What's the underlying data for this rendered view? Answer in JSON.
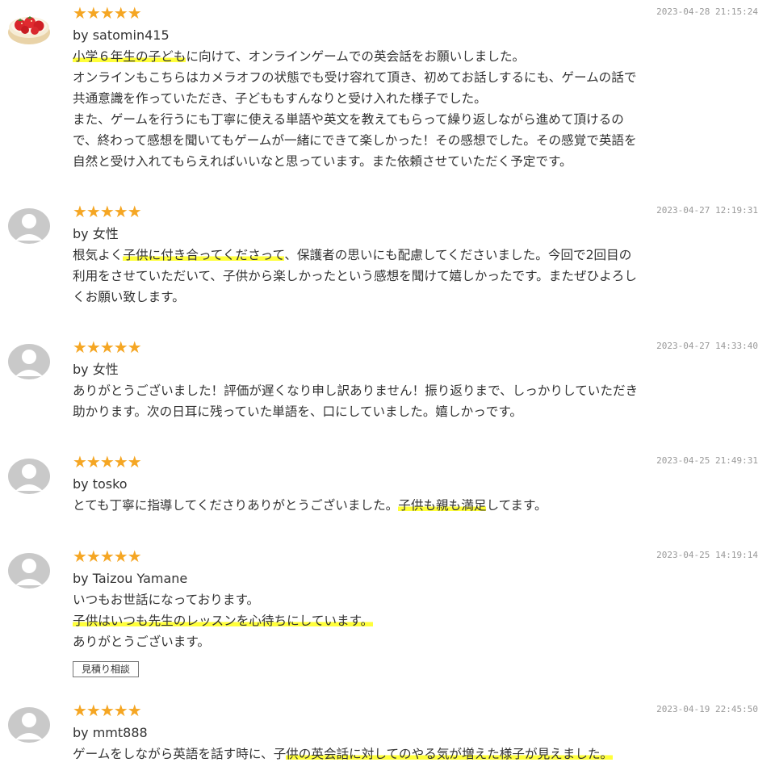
{
  "reviews": [
    {
      "stars": "★★★★★",
      "date": "2023-04-28 21:15:24",
      "author": "by satomin415",
      "avatar": "strawberry-cake-icon",
      "lines": [
        {
          "a": "",
          "h": "小学６年生の子ども",
          "b": "に向けて、オンラインゲームでの英会話をお願いしました。"
        },
        {
          "a": "オンラインもこちらはカメラオフの状態でも受け容れて頂き、初めてお話しするにも、ゲームの話で",
          "h": "",
          "b": ""
        },
        {
          "a": "共通意識を作っていただき、子どももすんなりと受け入れた様子でした。",
          "h": "",
          "b": ""
        },
        {
          "a": "また、ゲームを行うにも丁寧に使える単語や英文を教えてもらって繰り返しながら進めて頂けるの",
          "h": "",
          "b": ""
        },
        {
          "a": "で、終わって感想を聞いてもゲームが一緒にできて楽しかった！その感想でした。その感覚で英語を",
          "h": "",
          "b": ""
        },
        {
          "a": "自然と受け入れてもらえればいいなと思っています。また依頼させていただく予定です。",
          "h": "",
          "b": ""
        }
      ]
    },
    {
      "stars": "★★★★★",
      "date": "2023-04-27 12:19:31",
      "author": "by 女性",
      "avatar": "default-user-icon",
      "lines": [
        {
          "a": "根気よく",
          "h": "子供に付き合ってくださって",
          "b": "、保護者の思いにも配慮してくださいました。今回で2回目の"
        },
        {
          "a": "利用をさせていただいて、子供から楽しかったという感想を聞けて嬉しかったです。またぜひよろし",
          "h": "",
          "b": ""
        },
        {
          "a": "くお願い致します。",
          "h": "",
          "b": ""
        }
      ]
    },
    {
      "stars": "★★★★★",
      "date": "2023-04-27 14:33:40",
      "author": "by 女性",
      "avatar": "default-user-icon",
      "lines": [
        {
          "a": "ありがとうございました！評価が遅くなり申し訳ありません！振り返りまで、しっかりしていただき",
          "h": "",
          "b": ""
        },
        {
          "a": "助かります。次の日耳に残っていた単語を、口にしていました。嬉しかっです。",
          "h": "",
          "b": ""
        }
      ]
    },
    {
      "stars": "★★★★★",
      "date": "2023-04-25 21:49:31",
      "author": "by tosko",
      "avatar": "default-user-icon",
      "lines": [
        {
          "a": "とても丁寧に指導してくださりありがとうございました。",
          "h": "子供も親も満足",
          "b": "してます。"
        }
      ]
    },
    {
      "stars": "★★★★★",
      "date": "2023-04-25 14:19:14",
      "author": "by Taizou Yamane",
      "avatar": "default-user-icon",
      "lines": [
        {
          "a": "いつもお世話になっております。",
          "h": "",
          "b": ""
        },
        {
          "a": "",
          "h": "子供はいつも先生のレッスンを心待ちにしています。",
          "b": ""
        },
        {
          "a": "ありがとうございます。",
          "h": "",
          "b": ""
        }
      ],
      "tag": "見積り相談"
    },
    {
      "stars": "★★★★★",
      "date": "2023-04-19 22:45:50",
      "author": "by mmt888",
      "avatar": "default-user-icon",
      "lines": [
        {
          "a": "ゲームをしながら英語を話す時に、子",
          "h": "供の英会話に対してのやる気が増えた様子が見えました。",
          "b": ""
        }
      ]
    }
  ]
}
